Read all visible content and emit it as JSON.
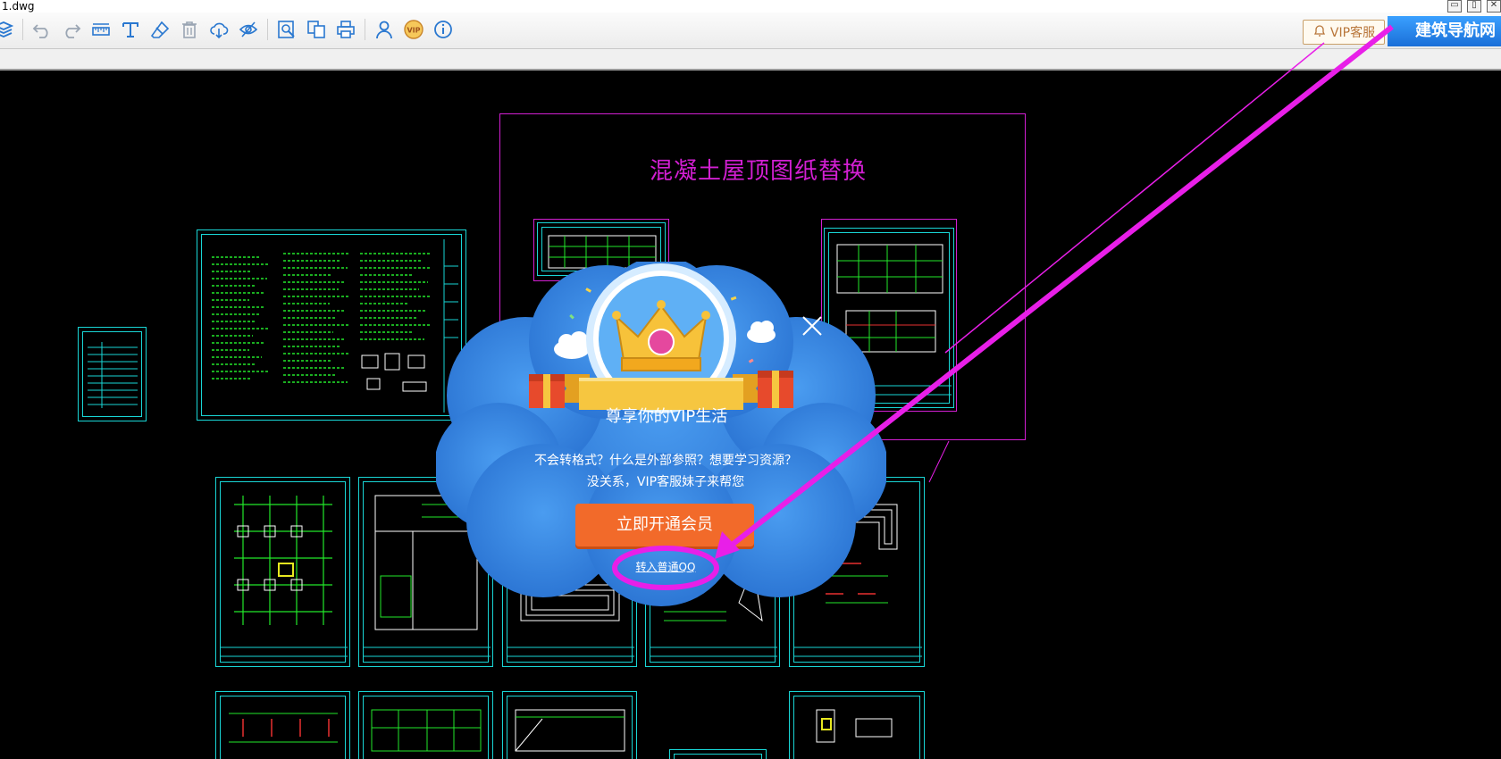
{
  "window": {
    "title": "1.dwg",
    "controls": [
      "▭",
      "▯",
      "✕"
    ]
  },
  "toolbar": {
    "tools": [
      "layers-icon",
      "undo-icon",
      "redo-icon",
      "measure-icon",
      "text-icon",
      "eraser-icon",
      "delete-icon",
      "cloud-download-icon",
      "hide-icon",
      "search-zoom-icon",
      "compare-icon",
      "print-icon",
      "user-icon",
      "vip-icon",
      "info-icon"
    ],
    "vip_service_label": "VIP客服",
    "brand_label": "建筑导航网"
  },
  "drawing": {
    "title": "混凝土屋顶图纸替换"
  },
  "popup": {
    "title": "尊享你的VIP生活",
    "desc_line1": "不会转格式？什么是外部参照？想要学习资源？",
    "desc_line2": "没关系，VIP客服妹子来帮您",
    "cta": "立即开通会员",
    "link": "转入普通QQ"
  },
  "colors": {
    "accent": "#2f7fd6",
    "cta": "#f26a2a",
    "annotation": "#e81fe8",
    "cad_cyan": "#19d6d6",
    "cad_green": "#22e82a"
  }
}
